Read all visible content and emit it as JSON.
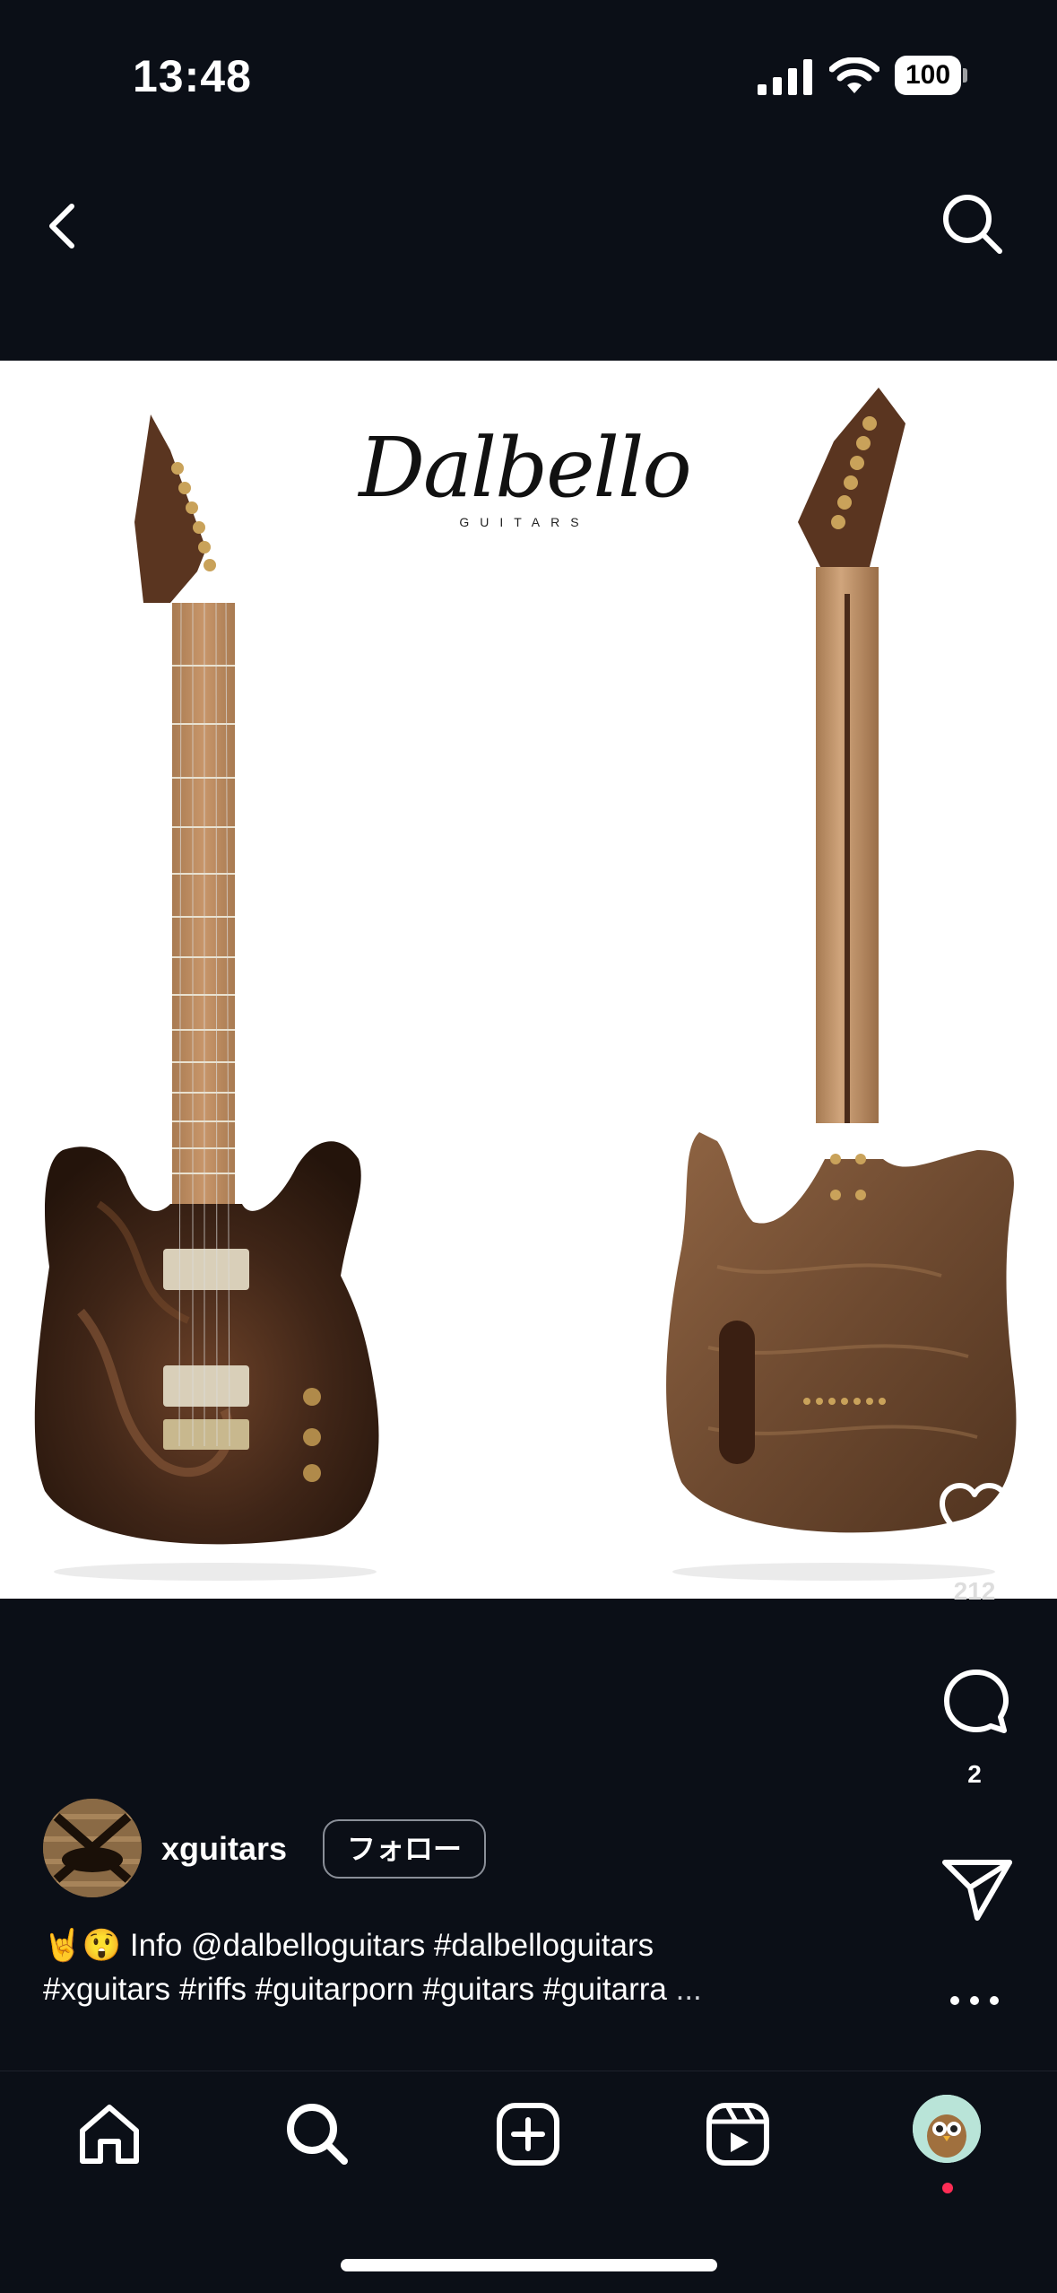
{
  "status_bar": {
    "time": "13:48",
    "battery": "100",
    "icons": [
      "signal-icon",
      "wifi-icon",
      "battery-icon"
    ]
  },
  "header": {
    "icons": [
      "chevron-left-icon",
      "search-icon"
    ]
  },
  "media": {
    "logo_text": "Dalbello",
    "logo_subtext": "GUITARS"
  },
  "actions": {
    "like_count": "212",
    "comment_count": "2",
    "icons": [
      "heart-icon",
      "comment-icon",
      "send-icon",
      "more-icon"
    ]
  },
  "post": {
    "username": "xguitars",
    "follow_label": "フォロー",
    "caption_emoji": "🤘😲",
    "caption_line1": "Info @dalbelloguitars #dalbelloguitars",
    "caption_line2": "#xguitars #riffs #guitarporn #guitars #guitarra",
    "caption_ellipsis": "..."
  },
  "tab_bar": {
    "tabs": [
      "home-icon",
      "search-icon",
      "create-icon",
      "reels-icon",
      "profile-avatar"
    ]
  },
  "colors": {
    "background": "#0b0f17",
    "media_background": "#ffffff",
    "notification_dot": "#ff2d55",
    "wood_dark": "#4a2b1a",
    "wood_light": "#8a5a3a"
  }
}
